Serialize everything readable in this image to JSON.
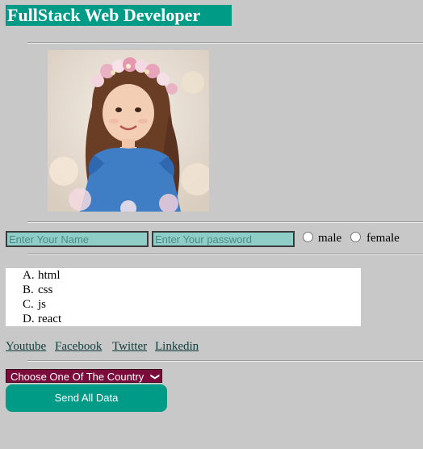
{
  "header": {
    "title": "FullStack Web Developer"
  },
  "profile": {
    "photo_icon": "girl-with-flower-crown-photo"
  },
  "form": {
    "name_placeholder": "Enter Your Name",
    "password_placeholder": "Enter Your password",
    "gender_options": [
      "male",
      "female"
    ]
  },
  "skills": {
    "items": [
      {
        "marker": "A.",
        "label": "html"
      },
      {
        "marker": "B.",
        "label": "css"
      },
      {
        "marker": "C.",
        "label": "js"
      },
      {
        "marker": "D.",
        "label": "react"
      }
    ]
  },
  "links": {
    "items": [
      "Youtube",
      "Facebook",
      "Twitter",
      "Linkedin"
    ]
  },
  "country": {
    "selected": "Choose One Of The Country"
  },
  "actions": {
    "send_label": "Send All Data"
  },
  "colors": {
    "background": "#c8c8c8",
    "accent": "#009b87",
    "input_fill": "#8fcdc7",
    "select_fill": "#7a0b3a"
  }
}
